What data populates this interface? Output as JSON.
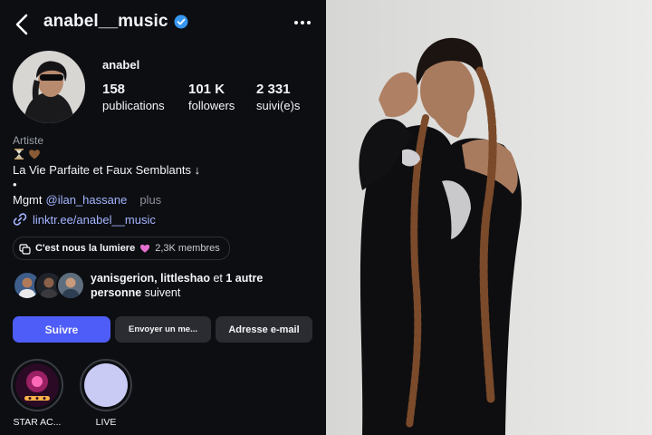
{
  "header": {
    "handle": "anabel__music"
  },
  "profile": {
    "name": "anabel",
    "stats": [
      {
        "value": "158",
        "label": "publications"
      },
      {
        "value": "101 K",
        "label": "followers"
      },
      {
        "value": "2 331",
        "label": "suivi(e)s"
      }
    ],
    "category": "Artiste",
    "bio_line": "La Vie Parfaite et Faux Semblants ↓",
    "bio_dot": "•",
    "mgmt_prefix": "Mgmt",
    "mgmt_mention": "@ilan_hassane",
    "more_label": "plus",
    "link": "linktr.ee/anabel__music"
  },
  "channel": {
    "title": "C'est nous la lumiere",
    "members": "2,3K membres"
  },
  "followed_by": {
    "names": "yanisgerion, littleshao",
    "connector": " et ",
    "others": "1 autre personne",
    "suffix": " suivent"
  },
  "buttons": {
    "follow": "Suivre",
    "message": "Envoyer un me...",
    "email": "Adresse e-mail"
  },
  "highlights": [
    {
      "label": "STAR AC..."
    },
    {
      "label": "LIVE"
    }
  ],
  "colors": {
    "accent": "#4f5df8",
    "link": "#a5b4ff",
    "verified": "#3897f0"
  },
  "icons": {
    "back": "chevron-left-icon",
    "verified": "verified-badge-icon",
    "more": "more-dots-icon",
    "link": "link-icon",
    "channel": "broadcast-channel-icon"
  }
}
